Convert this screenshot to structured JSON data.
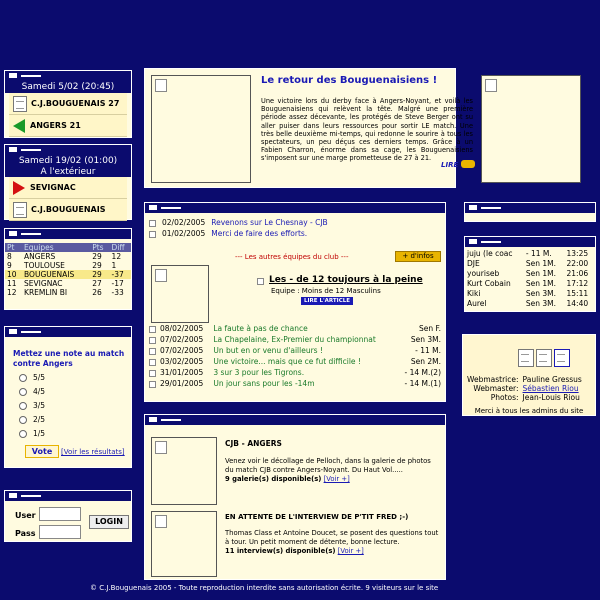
{
  "match1": {
    "date": "Samedi 5/02 (20:45)",
    "home": "C.J.BOUGUENAIS",
    "home_score": "27",
    "away": "ANGERS",
    "away_score": "21"
  },
  "match2": {
    "date": "Samedi 19/02 (01:00)",
    "location": "A l'extérieur",
    "team1": "SEVIGNAC",
    "team2": "C.J.BOUGUENAIS"
  },
  "ranking": {
    "headers": [
      "Pt",
      "Equipes",
      "Pts",
      "Diff"
    ],
    "rows": [
      [
        "8",
        "ANGERS",
        "29",
        "12"
      ],
      [
        "9",
        "TOULOUSE",
        "29",
        "1"
      ],
      [
        "10",
        "BOUGUENAIS",
        "29",
        "-37"
      ],
      [
        "11",
        "SEVIGNAC",
        "27",
        "-17"
      ],
      [
        "12",
        "KREMLIN BI",
        "26",
        "-33"
      ]
    ]
  },
  "poll": {
    "title": "Mettez une note au match contre Angers",
    "options": [
      "5/5",
      "4/5",
      "3/5",
      "2/5",
      "1/5"
    ],
    "vote_label": "Vote",
    "results_link": "[Voir les résultats]"
  },
  "login": {
    "user_label": "User",
    "pass_label": "Pass",
    "button": "LOGIN"
  },
  "featured": {
    "title": "Le retour des Bouguenaisiens !",
    "body": "Une victoire lors du derby face à Angers-Noyant, et voilà les Bouguenaisiens qui relèvent la tête. Malgré une première période assez décevante, les protégés de Steve Berger ont su aller puiser dans leurs ressources pour sortir LE match. Une très belle deuxième mi-temps, qui redonne le sourire à tous les spectateurs, un peu déçus ces derniers temps. Grâce à un Fabien Charron, énorme dans sa cage, les Bouguenaisiens s'imposent sur une marge prometteuse de 27 à 21.",
    "read_label": "LIRE"
  },
  "news_top": [
    {
      "date": "02/02/2005",
      "text": "Revenons sur Le Chesnay - CJB"
    },
    {
      "date": "01/02/2005",
      "text": "Merci de faire des efforts."
    }
  ],
  "other_teams": {
    "label": "--- Les autres équipes du club ---",
    "infos": "+ d'infos"
  },
  "team_article": {
    "title": "Les - de 12 toujours à la peine",
    "subtitle": "Equipe : Moins de 12 Masculins",
    "read_label": "LIRE L'ARTICLE"
  },
  "news_bottom": [
    {
      "date": "08/02/2005",
      "text": "La faute à pas de chance",
      "team": "Sen F."
    },
    {
      "date": "07/02/2005",
      "text": "La Chapelaine, Ex-Premier du championnat",
      "team": "Sen 3M."
    },
    {
      "date": "07/02/2005",
      "text": "Un but en or venu d'ailleurs !",
      "team": "- 11 M."
    },
    {
      "date": "03/02/2005",
      "text": "Une victoire... mais que ce fut difficile !",
      "team": "Sen 2M."
    },
    {
      "date": "31/01/2005",
      "text": "3 sur 3 pour les Tigrons.",
      "team": "- 14 M.(2)"
    },
    {
      "date": "29/01/2005",
      "text": "Un jour sans pour les -14m",
      "team": "- 14 M.(1)"
    }
  ],
  "gallery": {
    "title": "CJB - ANGERS",
    "body": "Venez voir le décollage de Pelloch, dans la galerie de photos du match CJB contre Angers-Noyant. Du Haut Vol.....",
    "count": "9 galerie(s) disponible(s)",
    "more": "[Voir +]"
  },
  "interview": {
    "title": "EN ATTENTE DE L'INTERVIEW DE P'TIT FRED ;-)",
    "body": "Thomas Class et Antoine Doucet, se posent des questions tout à tour. Un petit moment de détente, bonne lecture.",
    "count": "11 interview(s) disponible(s)",
    "more": "[Voir +]"
  },
  "chat": [
    [
      "juju (le coac",
      "- 11 M.",
      "13:25"
    ],
    [
      "DJE",
      "Sen 1M.",
      "22:00"
    ],
    [
      "youriseb",
      "Sen 1M.",
      "21:06"
    ],
    [
      "Kurt Cobain",
      "Sen 1M.",
      "17:12"
    ],
    [
      "Kiki",
      "Sen 3M.",
      "15:11"
    ],
    [
      "Aurel",
      "Sen 3M.",
      "14:40"
    ]
  ],
  "admins": {
    "rows": [
      [
        "Webmastrice:",
        "Pauline Gressus"
      ],
      [
        "Webmaster:",
        "Sébastien Riou"
      ],
      [
        "Photos:",
        "Jean-Louis Riou"
      ]
    ],
    "thanks": "Merci à tous les admins du site"
  },
  "footer": {
    "text": "© C.J.Bouguenais 2005 - Toute reproduction interdite sans autorisation écrite. 9 visiteurs sur le site"
  },
  "colors": {
    "background": "#0b0b6e",
    "panel": "#fffbe0",
    "link": "#1a1ab4",
    "accent": "#e8b400"
  }
}
